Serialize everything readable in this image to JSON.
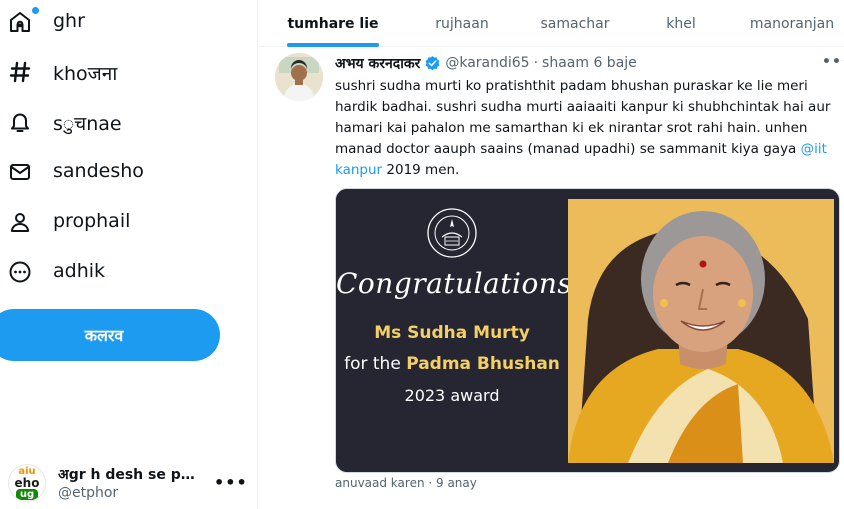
{
  "sidebar": {
    "items": [
      {
        "label": "ghr",
        "icon": "home-icon"
      },
      {
        "label": "khoजना",
        "icon": "hashtag-icon"
      },
      {
        "label": "sुचnae",
        "icon": "bell-icon"
      },
      {
        "label": "sandesho",
        "icon": "envelope-icon"
      },
      {
        "label": "prophail",
        "icon": "person-icon"
      },
      {
        "label": "adhik",
        "icon": "more-circle-icon"
      }
    ],
    "post_button": "कलरव",
    "account": {
      "name": "अgr h desh se pyaar hai…",
      "handle": "@etphor",
      "avatar_lines": [
        "aiu",
        "eho",
        "ug"
      ]
    }
  },
  "tabs": [
    {
      "label": "tumhare lie",
      "active": true
    },
    {
      "label": "rujhaan",
      "active": false
    },
    {
      "label": "samachar",
      "active": false
    },
    {
      "label": "khel",
      "active": false
    },
    {
      "label": "manoranjan",
      "active": false
    }
  ],
  "tweet": {
    "author_name": "अभय करनदाकर",
    "handle": "@karandi65",
    "time": "shaam 6 baje",
    "text_main": "sushri sudha murti ko pratishthit padam bhushan puraskar ke lie meri hardik badhai. sushri sudha murti aaiaaiti kanpur ki shubhchintak hai aur hamari kai pahalon me samarthan ki ek nirantar srot rahi hain. unhen manad doctor aauph saains (manad upadhi) se sammanit kiya gaya",
    "text_link": "@iit kanpur",
    "text_tail": "2019 men.",
    "media": {
      "congrats": "Congratulations!",
      "honoree": "Ms Sudha Murty",
      "award_prefix": "for the",
      "award_name": "Padma Bhushan",
      "award_year": "2023 award"
    },
    "translate_text": "anuvaad karen · 9 anay"
  },
  "colors": {
    "accent": "#1d9bf0",
    "media_bg": "#262633",
    "media_gold": "#ecbc5a",
    "highlight_text": "#f4cf64"
  }
}
